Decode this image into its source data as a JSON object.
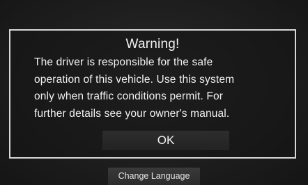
{
  "warning_dialog": {
    "title": "Warning!",
    "message_lines": [
      "The driver is responsible for the safe",
      "operation of this vehicle. Use this system",
      "only when traffic conditions permit. For",
      "further details see your owner's manual."
    ],
    "ok_label": "OK"
  },
  "footer": {
    "change_language_label": "Change Language"
  }
}
